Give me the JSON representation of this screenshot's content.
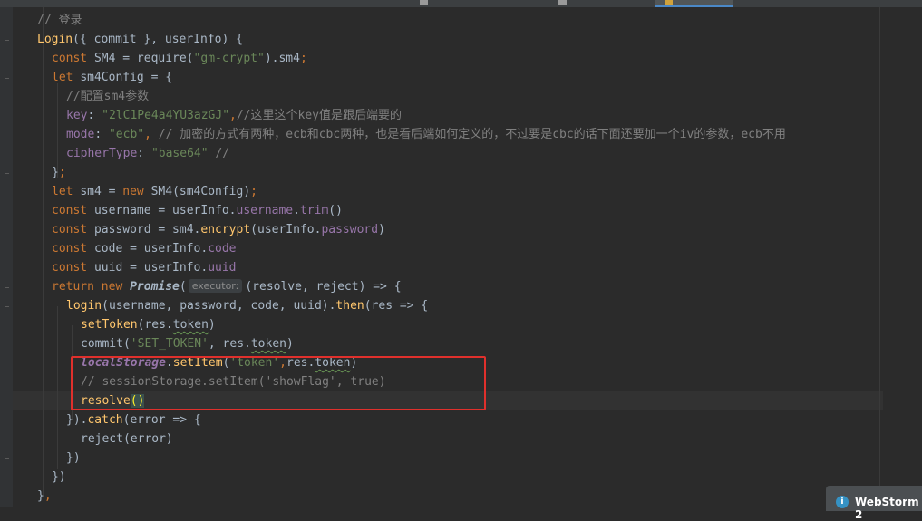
{
  "editor": {
    "hint_executor": "executor:",
    "lines": [
      "// 登录",
      "Login({ commit }, userInfo) {",
      "const SM4 = require(\"gm-crypt\").sm4;",
      "let sm4Config = {",
      "//配置sm4参数",
      "key: \"2lC1Pe4a4YU3azGJ\",//这里这个key值是跟后端要的",
      "mode: \"ecb\", // 加密的方式有两种，ecb和cbc两种，也是看后端如何定义的，不过要是cbc的话下面还要加一个iv的参数，ecb不用",
      "cipherType: \"base64\" //",
      "};",
      "let sm4 = new SM4(sm4Config);",
      "const username = userInfo.username.trim()",
      "const password = sm4.encrypt(userInfo.password)",
      "const code = userInfo.code",
      "const uuid = userInfo.uuid",
      "return new Promise( executor: (resolve, reject) => {",
      "login(username, password, code, uuid).then(res => {",
      "setToken(res.token)",
      "commit('SET_TOKEN', res.token)",
      "localStorage.setItem('token',res.token)",
      "// sessionStorage.setItem('showFlag', true)",
      "resolve()",
      "}).catch(error => {",
      "reject(error)",
      "})",
      "})",
      "},"
    ]
  },
  "notification": {
    "text": "WebStorm 2"
  },
  "colors": {
    "background": "#2b2b2b",
    "keyword": "#cc7832",
    "function": "#ffc66d",
    "string": "#6a8759",
    "comment": "#808080",
    "property": "#9876aa",
    "highlight_box": "#e0302c"
  }
}
